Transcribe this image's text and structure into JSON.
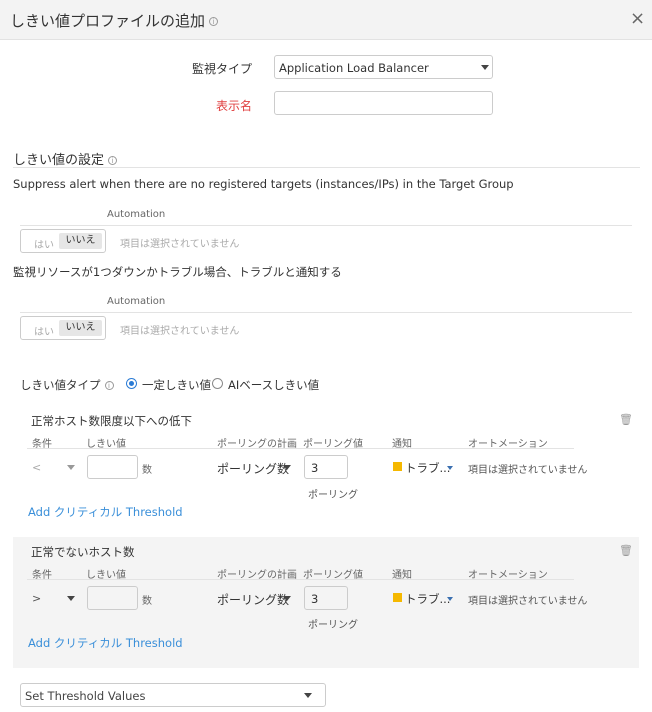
{
  "dialog": {
    "title": "しきい値プロファイルの追加",
    "close": "×"
  },
  "form": {
    "monitor_type_label": "監視タイプ",
    "monitor_type_value": "Application Load Balancer",
    "display_name_label": "表示名",
    "display_name_value": ""
  },
  "threshold_settings": {
    "heading": "しきい値の設定",
    "suppress": {
      "text": "Suppress alert when there are no registered targets (instances/IPs) in the Target Group",
      "automation_label": "Automation",
      "yes": "はい",
      "no": "いいえ",
      "selected": "いいえ",
      "placeholder": "項目は選択されていません"
    },
    "resource_down": {
      "text": "監視リソースが1つダウンかトラブル場合、トラブルと通知する",
      "automation_label": "Automation",
      "yes": "はい",
      "no": "いいえ",
      "selected": "いいえ",
      "placeholder": "項目は選択されていません"
    },
    "type_label": "しきい値タイプ",
    "type_options": [
      "一定しきい値",
      "AIベースしきい値"
    ],
    "type_selected": "一定しきい値"
  },
  "columns": [
    "条件",
    "しきい値",
    "ポーリングの計画",
    "ポーリング値",
    "通知",
    "オートメーション"
  ],
  "sections": [
    {
      "title": "正常ホスト数限度以下への低下",
      "condition": "<",
      "threshold": "",
      "unit": "数",
      "poll_plan": "ポーリング数",
      "poll_value": "3",
      "poll_unit": "ポーリング",
      "notify": "トラブ...",
      "notify_color": "#f5b800",
      "automation": "項目は選択されていません",
      "add_link": "Add クリティカル Threshold"
    },
    {
      "title": "正常でないホスト数",
      "condition": ">",
      "threshold": "",
      "unit": "数",
      "poll_plan": "ポーリング数",
      "poll_value": "3",
      "poll_unit": "ポーリング",
      "notify": "トラブ...",
      "notify_color": "#f5b800",
      "automation": "項目は選択されていません",
      "add_link": "Add クリティカル Threshold"
    }
  ],
  "footer": {
    "set_threshold": "Set Threshold Values"
  }
}
